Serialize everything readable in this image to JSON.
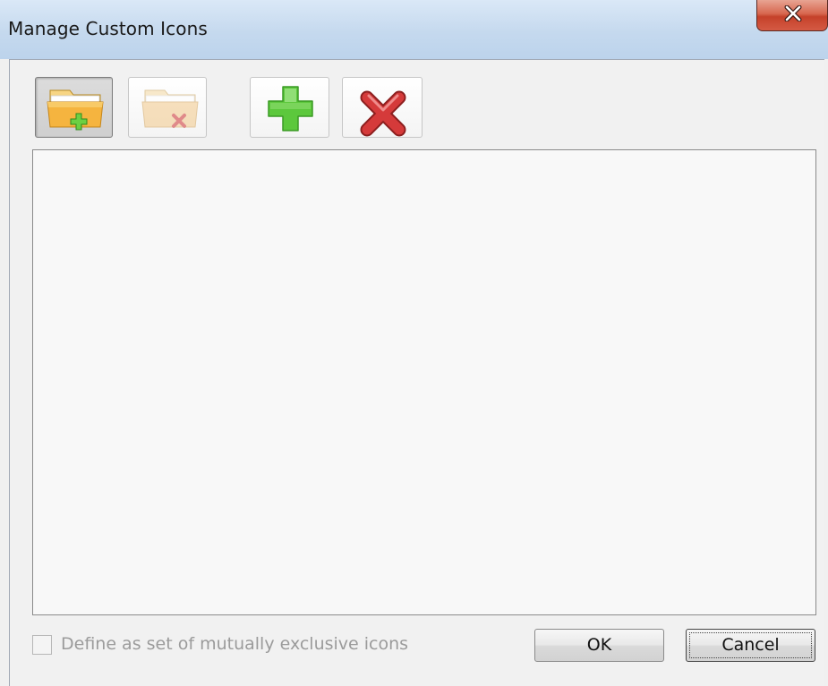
{
  "window": {
    "title": "Manage Custom Icons"
  },
  "toolbar": {
    "buttons": [
      {
        "icon": "folder-add-icon",
        "state": "pressed"
      },
      {
        "icon": "folder-remove-icon",
        "state": "disabled"
      },
      {
        "icon": "add-icon",
        "state": "normal"
      },
      {
        "icon": "delete-icon",
        "state": "normal"
      }
    ]
  },
  "icon_list": {
    "items": []
  },
  "options": {
    "mutually_exclusive_label": "Define as set of mutually exclusive icons",
    "mutually_exclusive_checked": false,
    "mutually_exclusive_enabled": false
  },
  "buttons": {
    "ok_label": "OK",
    "cancel_label": "Cancel"
  },
  "colors": {
    "titlebar": "#c5d9ee",
    "close_button": "#c5412a",
    "add_green": "#5cc83c",
    "delete_red": "#d53a3a",
    "folder": "#f5b43f"
  }
}
